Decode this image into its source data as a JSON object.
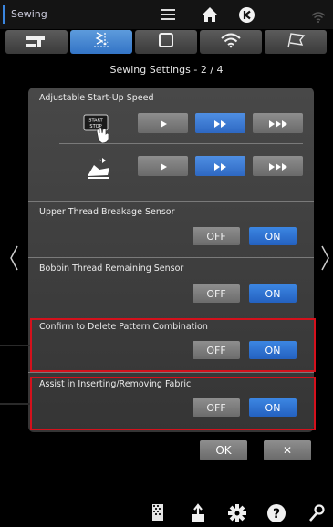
{
  "status_bar": {
    "title": "Sewing",
    "icons": [
      "menu-icon",
      "home-icon",
      "back-icon",
      "wifi-icon"
    ]
  },
  "tabs": [
    {
      "icon": "sewing-machine-icon",
      "active": false
    },
    {
      "icon": "stitch-icon",
      "active": true
    },
    {
      "icon": "embroidery-frame-icon",
      "active": false
    },
    {
      "icon": "wifi-icon",
      "active": false
    },
    {
      "icon": "flag-icon",
      "active": false
    }
  ],
  "page_title": "Sewing Settings - 2 / 4",
  "settings": {
    "startup_speed": {
      "label": "Adjustable Start-Up Speed",
      "start_stop_label_1": "START",
      "start_stop_label_2": "STOP",
      "row1_selected": "medium",
      "row2_selected": "medium"
    },
    "upper_thread": {
      "label": "Upper Thread Breakage Sensor",
      "off": "OFF",
      "on": "ON",
      "value": "ON"
    },
    "bobbin_thread": {
      "label": "Bobbin Thread Remaining Sensor",
      "off": "OFF",
      "on": "ON",
      "value": "ON"
    },
    "confirm_delete": {
      "label": "Confirm to Delete Pattern Combination",
      "off": "OFF",
      "on": "ON",
      "value": "ON"
    },
    "assist_fabric": {
      "label": "Assist in Inserting/Removing Fabric",
      "off": "OFF",
      "on": "ON",
      "value": "ON"
    }
  },
  "dialog": {
    "ok": "OK",
    "cancel": "✕"
  },
  "nav": {
    "prev": "prev-page-arrow",
    "next": "next-page-arrow"
  },
  "bottom_icons": [
    "pattern-icon",
    "export-icon",
    "settings-icon",
    "help-icon",
    "wrench-icon"
  ],
  "colors": {
    "active_blue": "#3374c6",
    "highlight_red": "#d4111c",
    "panel_gray": "#404040"
  }
}
